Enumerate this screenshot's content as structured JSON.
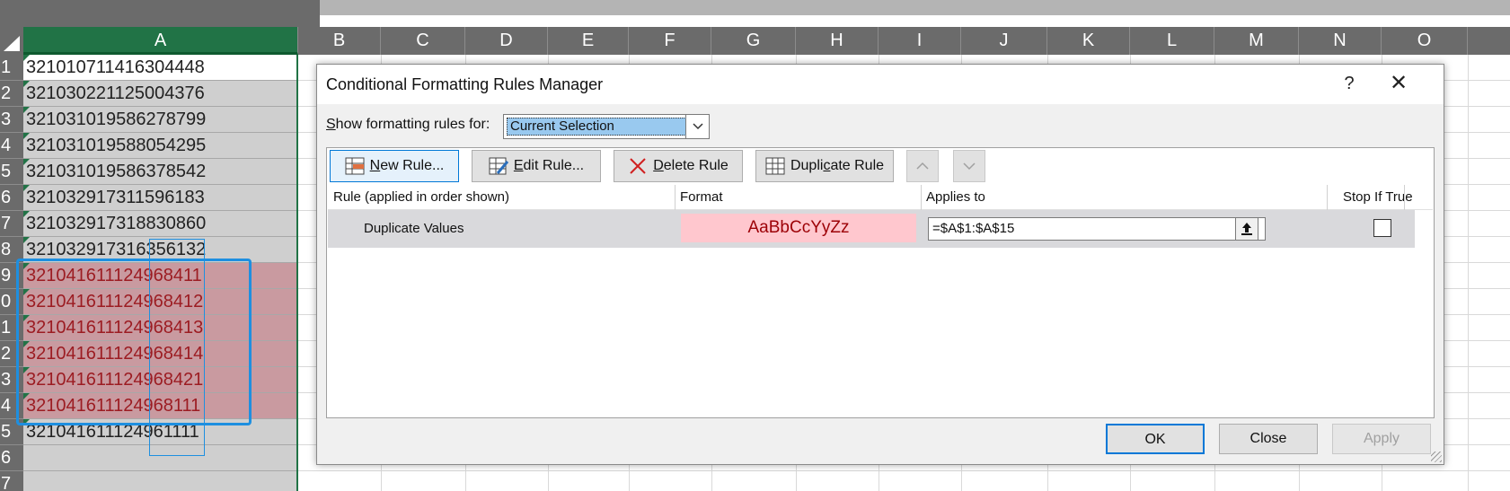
{
  "spreadsheet": {
    "columns": [
      "A",
      "B",
      "C",
      "D",
      "E",
      "F",
      "G",
      "H",
      "I",
      "J",
      "K",
      "L",
      "M",
      "N",
      "O"
    ],
    "selected_column": "A",
    "rows": [
      {
        "num": "1",
        "value": "321010711416304448",
        "dup": false
      },
      {
        "num": "2",
        "value": "321030221125004376",
        "dup": false
      },
      {
        "num": "3",
        "value": "321031019586278799",
        "dup": false
      },
      {
        "num": "4",
        "value": "321031019588054295",
        "dup": false
      },
      {
        "num": "5",
        "value": "321031019586378542",
        "dup": false
      },
      {
        "num": "6",
        "value": "321032917311596183",
        "dup": false
      },
      {
        "num": "7",
        "value": "321032917318830860",
        "dup": false
      },
      {
        "num": "8",
        "value": "321032917316356132",
        "dup": false
      },
      {
        "num": "9",
        "value": "321041611124968411",
        "dup": true
      },
      {
        "num": "0",
        "value": "321041611124968412",
        "dup": true
      },
      {
        "num": "1",
        "value": "321041611124968413",
        "dup": true
      },
      {
        "num": "2",
        "value": "321041611124968414",
        "dup": true
      },
      {
        "num": "3",
        "value": "321041611124968421",
        "dup": true
      },
      {
        "num": "4",
        "value": "321041611124968111",
        "dup": true
      },
      {
        "num": "5",
        "value": "321041611124961111",
        "dup": false
      },
      {
        "num": "6",
        "value": "",
        "dup": false
      },
      {
        "num": "7",
        "value": "",
        "dup": false
      }
    ]
  },
  "dialog": {
    "title": "Conditional Formatting Rules Manager",
    "help": "?",
    "close": "✕",
    "show_rules_label_pre": "",
    "show_rules_label_accel": "S",
    "show_rules_label_post": "how formatting rules for:",
    "show_rules_value": "Current Selection",
    "toolbar": {
      "new_rule_accel": "N",
      "new_rule_rest": "ew Rule...",
      "edit_rule_accel": "E",
      "edit_rule_rest": "dit Rule...",
      "delete_rule_accel": "D",
      "delete_rule_rest": "elete Rule",
      "duplicate_rule_pre": "Dupli",
      "duplicate_rule_accel": "c",
      "duplicate_rule_post": "ate Rule"
    },
    "columns": {
      "rule": "Rule (applied in order shown)",
      "format": "Format",
      "applies_to": "Applies to",
      "stop_if_true": "Stop If True"
    },
    "rules": [
      {
        "name": "Duplicate Values",
        "preview": "AaBbCcYyZz",
        "applies_to": "=$A$1:$A$15",
        "stop_if_true": false
      }
    ],
    "buttons": {
      "ok": "OK",
      "close": "Close",
      "apply": "Apply"
    }
  },
  "colors": {
    "excel_green": "#217346",
    "dup_fill": "#ffc7ce",
    "dup_text": "#9c0006",
    "focus_blue": "#0078d7"
  }
}
